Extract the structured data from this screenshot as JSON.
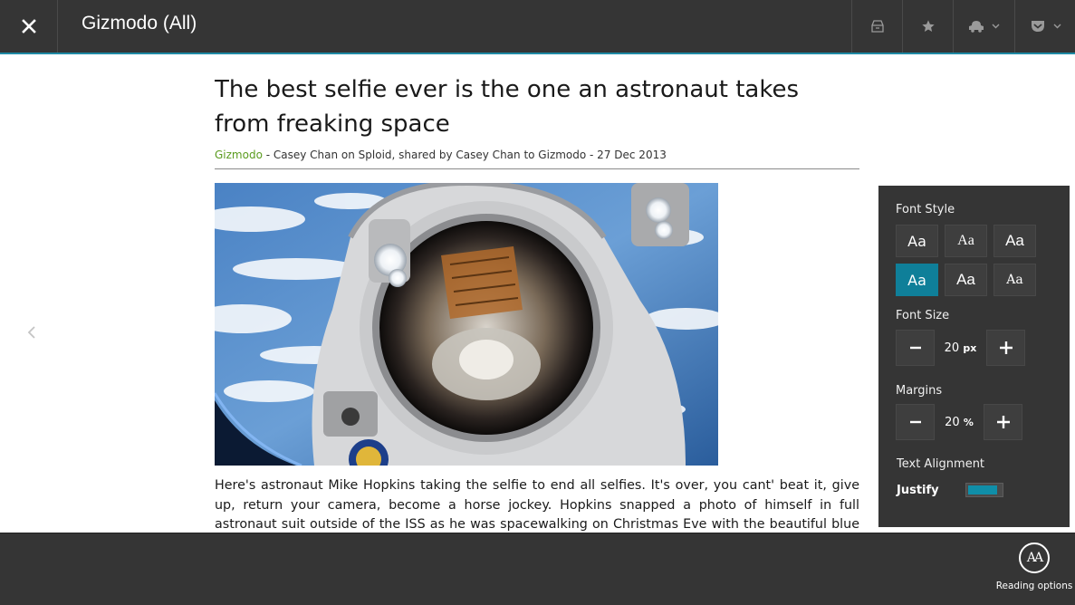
{
  "header": {
    "feed_title": "Gizmodo (All)",
    "icons": [
      "close-icon",
      "save-icon",
      "star-icon",
      "share-icon",
      "pocket-icon"
    ]
  },
  "article": {
    "title": "The best selfie ever is the one an astronaut takes from freaking space",
    "source": "Gizmodo",
    "byline": " - Casey Chan on Sploid, shared by Casey Chan to Gizmodo - 27 Dec 2013",
    "body": "Here's astronaut Mike Hopkins taking the selfie to end all selfies. It's over, you cant' beat it, give up, return your camera, become a horse jockey. Hopkins snapped a photo of himself in full astronaut suit outside of the ISS as he was spacewalking on Christmas Eve with the beautiful blue Earth in the"
  },
  "reading_panel": {
    "font_style_label": "Font Style",
    "font_options": [
      "Aa",
      "Aa",
      "Aa",
      "Aa",
      "Aa",
      "Aa"
    ],
    "selected_font_index": 3,
    "font_size_label": "Font Size",
    "font_size_value": "20",
    "font_size_unit": "px",
    "margins_label": "Margins",
    "margins_value": "20",
    "margins_unit": "%",
    "text_alignment_label": "Text Alignment",
    "alignment_value": "Justify",
    "alignment_toggle_fill": 0.8
  },
  "appbar": {
    "reading_options_icon_text": "AA",
    "reading_options_label": "Reading options"
  },
  "colors": {
    "accent": "#0f7f99",
    "source_link": "#5a9b1e",
    "bar_bg": "#353535"
  }
}
